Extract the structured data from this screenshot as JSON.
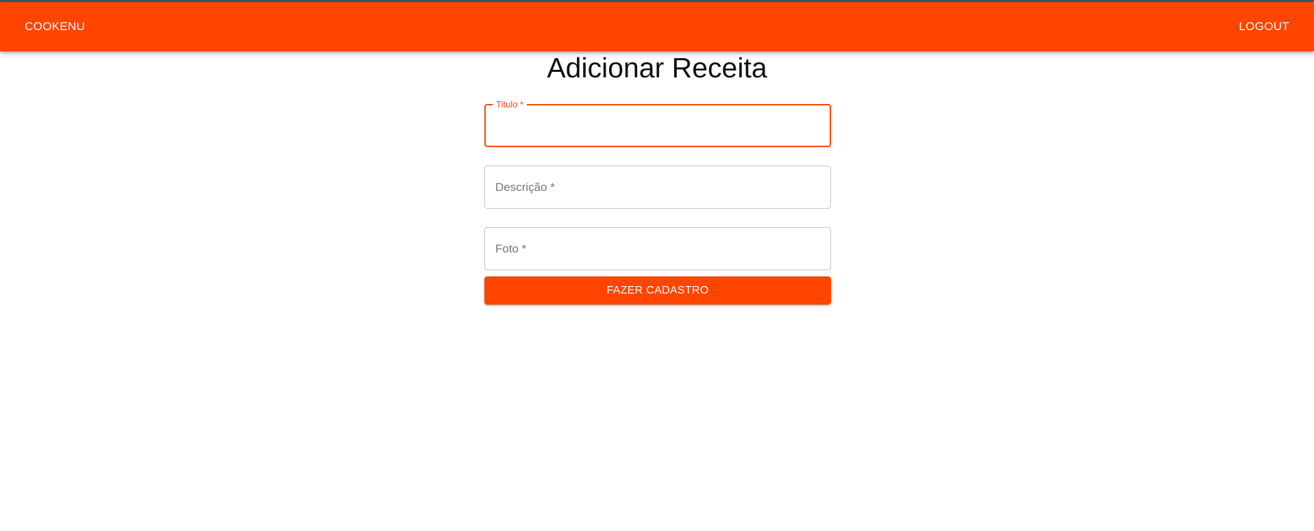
{
  "app_bar": {
    "brand_label": "COOKENU",
    "logout_label": "LOGOUT",
    "background_color": "#ff4500"
  },
  "page": {
    "title": "Adicionar Receita"
  },
  "form": {
    "fields": [
      {
        "label": "Titulo *",
        "value": "",
        "state": "focused"
      },
      {
        "label": "Descrição *",
        "value": "",
        "state": "default"
      },
      {
        "label": "Foto *",
        "value": "",
        "state": "default"
      }
    ],
    "submit_label": "FAZER CADASTRO",
    "accent_color": "#ff4500"
  }
}
